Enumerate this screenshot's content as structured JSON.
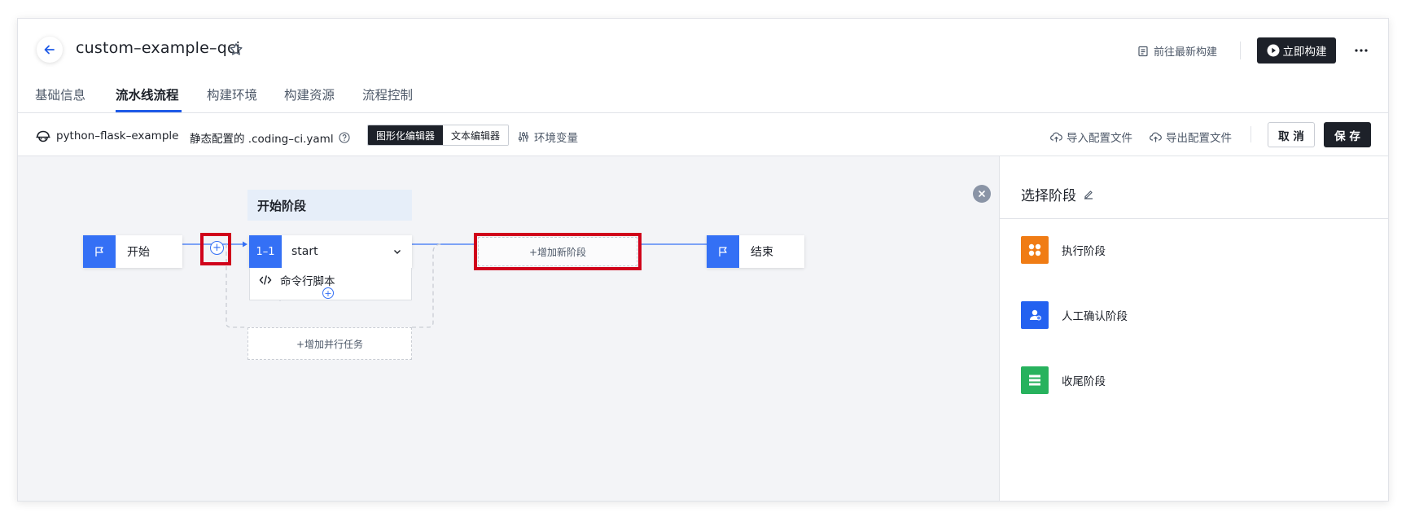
{
  "header": {
    "title": "custom–example–qci",
    "goto_latest": "前往最新构建",
    "build_now": "立即构建"
  },
  "tabs": [
    {
      "label": "基础信息"
    },
    {
      "label": "流水线流程"
    },
    {
      "label": "构建环境"
    },
    {
      "label": "构建资源"
    },
    {
      "label": "流程控制"
    }
  ],
  "toolbar": {
    "repo": "python–flask–example",
    "static_config": "静态配置的 .coding–ci.yaml",
    "editor_graphic": "图形化编辑器",
    "editor_text": "文本编辑器",
    "env_vars": "环境变量",
    "import_config": "导入配置文件",
    "export_config": "导出配置文件",
    "cancel": "取 消",
    "save": "保 存"
  },
  "pipeline": {
    "start_node": "开始",
    "end_node": "结束",
    "stage_title": "开始阶段",
    "job_number": "1–1",
    "job_name": "start",
    "step_name": "命令行脚本",
    "add_parallel": "+增加并行任务",
    "add_stage": "+增加新阶段"
  },
  "panel": {
    "title": "选择阶段",
    "types": [
      {
        "label": "执行阶段",
        "color": "#f07c14"
      },
      {
        "label": "人工确认阶段",
        "color": "#2361f0"
      },
      {
        "label": "收尾阶段",
        "color": "#27b25d"
      }
    ]
  },
  "colors": {
    "accent": "#3470f5",
    "dark": "#1d2129",
    "highlight": "#d0021b"
  }
}
